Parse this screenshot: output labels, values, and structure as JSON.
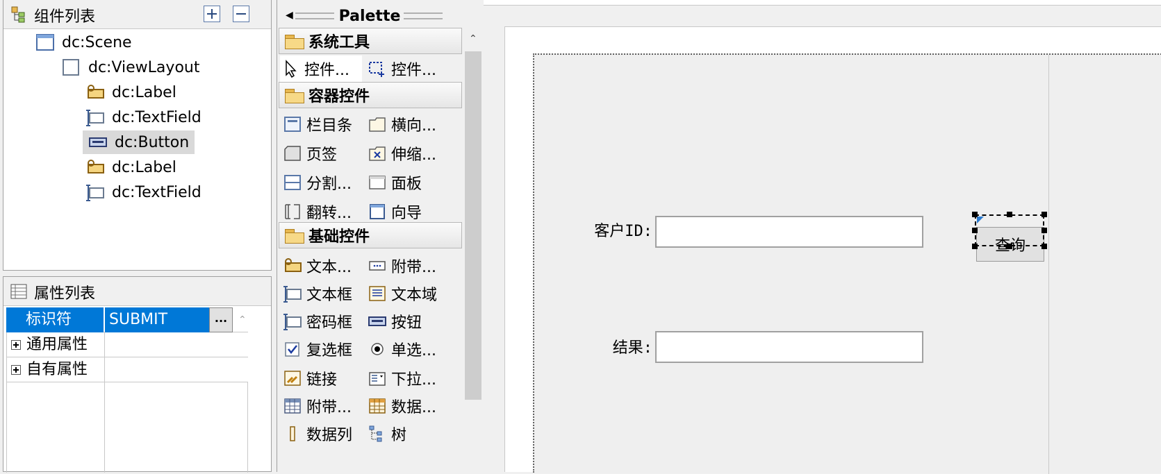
{
  "tree": {
    "title": "组件列表",
    "items": [
      {
        "label": "dc:Scene",
        "icon": "scene-icon"
      },
      {
        "label": "dc:ViewLayout",
        "icon": "viewlayout-icon"
      },
      {
        "label": "dc:Label",
        "icon": "label-icon"
      },
      {
        "label": "dc:TextField",
        "icon": "textfield-icon"
      },
      {
        "label": "dc:Button",
        "icon": "button-icon",
        "selected": true
      },
      {
        "label": "dc:Label",
        "icon": "label-icon"
      },
      {
        "label": "dc:TextField",
        "icon": "textfield-icon"
      }
    ]
  },
  "properties": {
    "title": "属性列表",
    "rows": [
      {
        "key": "标识符",
        "value": "SUBMIT",
        "highlighted": true
      },
      {
        "key": "通用属性",
        "value": "",
        "expandable": true
      },
      {
        "key": "自有属性",
        "value": "",
        "expandable": true
      }
    ],
    "ellipsis": "..."
  },
  "palette": {
    "title": "Palette",
    "categories": [
      {
        "label": "系统工具",
        "items": [
          "控件...",
          "控件..."
        ]
      },
      {
        "label": "容器控件",
        "items": [
          "栏目条",
          "横向...",
          "页签",
          "伸缩...",
          "分割...",
          "面板",
          "翻转...",
          "向导"
        ]
      },
      {
        "label": "基础控件",
        "items": [
          "文本...",
          "附带...",
          "文本框",
          "文本域",
          "密码框",
          "按钮",
          "复选框",
          "单选...",
          "链接",
          "下拉...",
          "附带...",
          "数据...",
          "数据列",
          "树"
        ]
      }
    ]
  },
  "form": {
    "customer_id_label": "客户ID:",
    "result_label": "结果:",
    "query_button": "查询"
  },
  "colors": {
    "selection": "#0078d7",
    "folder": "#f7d987"
  }
}
